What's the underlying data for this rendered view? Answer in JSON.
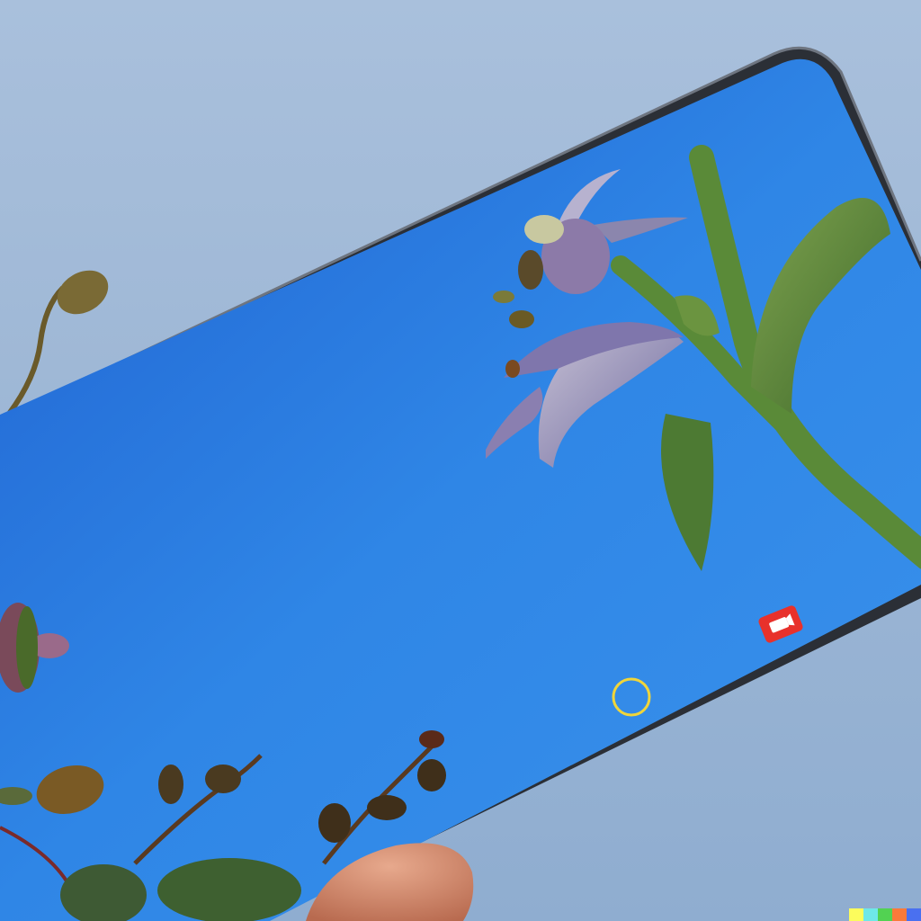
{
  "colors": {
    "sky": "#9fb8d6",
    "screen": "#2f7fe0",
    "phone_frame": "#2b2f36",
    "leaf": "#5f8a3a",
    "petal": "#a79bc4",
    "record_icon": "#e8312b",
    "focus_ring": "#f0d53a"
  },
  "icons": {
    "camera_mode": "video-record-icon",
    "focus": "focus-ring-icon"
  },
  "watermark_colors": [
    "#fcfc5c",
    "#6ee8e8",
    "#52d252",
    "#fa7a3a",
    "#4a70f0"
  ]
}
